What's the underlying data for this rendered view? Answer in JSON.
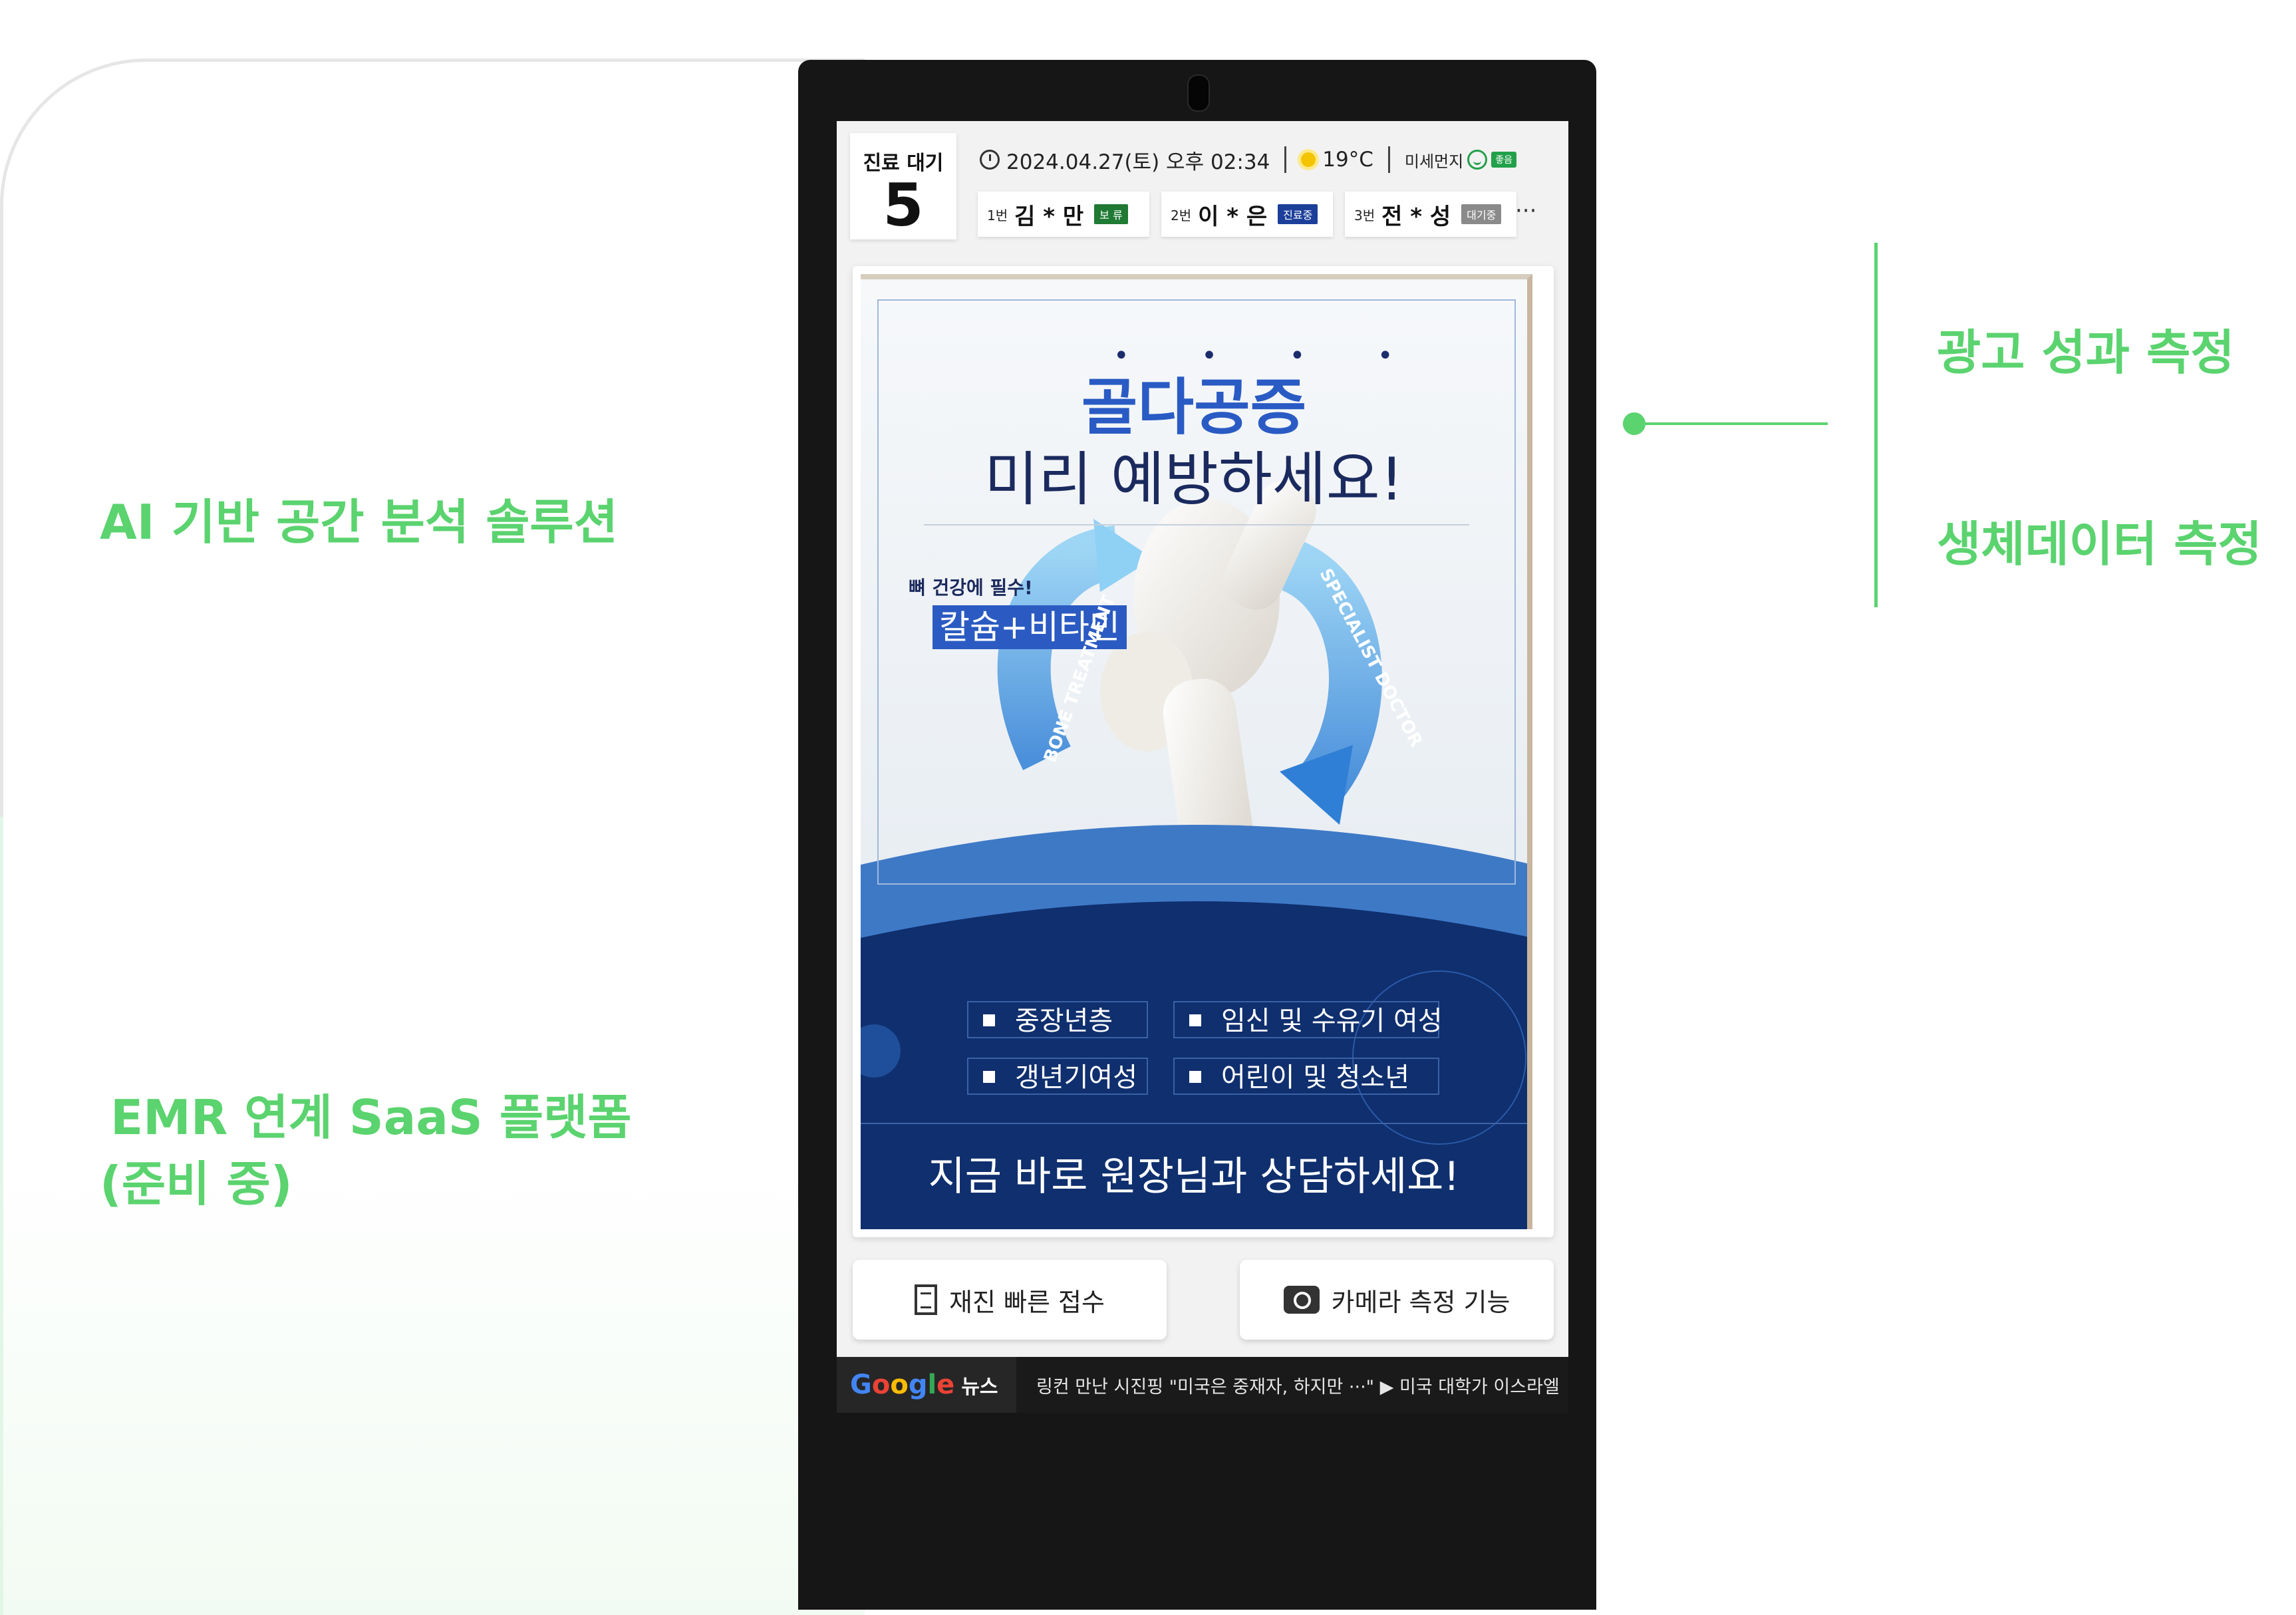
{
  "left_features": {
    "ai_analysis": "AI 기반 공간 분석 솔루션",
    "emr_line1": "EMR 연계 SaaS 플랫폼",
    "emr_line2": "(준비 중)"
  },
  "right_features": {
    "ad_performance": "광고 성과 측정",
    "biometric": "생체데이터 측정"
  },
  "kiosk": {
    "wait": {
      "label": "진료 대기",
      "count": "5"
    },
    "datetime": "2024.04.27(토) 오후 02:34",
    "weather": "19°C",
    "dust": {
      "label": "미세먼지",
      "level": "좋음"
    },
    "patients": [
      {
        "num": "1번",
        "name": "김 * 만",
        "status": "보 류",
        "status_color": "#1f7a34"
      },
      {
        "num": "2번",
        "name": "이 * 은",
        "status": "진료중",
        "status_color": "#1c3f9a"
      },
      {
        "num": "3번",
        "name": "전 * 성",
        "status": "대기중",
        "status_color": "#8a8a8a"
      }
    ],
    "more": "···",
    "ad": {
      "title_emphasis": "골다공증",
      "title_rest": "미리 예방하세요!",
      "badge_small": "뼈 건강에 필수!",
      "badge_main": "칼슘+비타민",
      "arc_left": "BONE TREATMENT",
      "arc_right": "SPECIALIST DOCTOR",
      "targets": [
        "중장년층",
        "임신 및 수유기 여성",
        "갱년기여성",
        "어린이 및 청소년"
      ],
      "cta": "지금 바로 원장님과 상담하세요!"
    },
    "buttons": {
      "quick_checkin": "재진 빠른 접수",
      "camera": "카메라 측정 기능"
    },
    "ticker": {
      "source": "뉴스",
      "google_letters": [
        "G",
        "o",
        "o",
        "g",
        "l",
        "e"
      ],
      "text": "링컨 만난 시진핑 \"미국은 중재자, 하지만 ···\"  ▶ 미국 대학가 이스라엘"
    }
  },
  "colors": {
    "accent_green": "#5bd36f",
    "ad_blue": "#2a5bc4",
    "ad_navy": "#0f2f6e",
    "google": [
      "#4285F4",
      "#EA4335",
      "#FBBC05",
      "#4285F4",
      "#34A853",
      "#EA4335"
    ]
  }
}
